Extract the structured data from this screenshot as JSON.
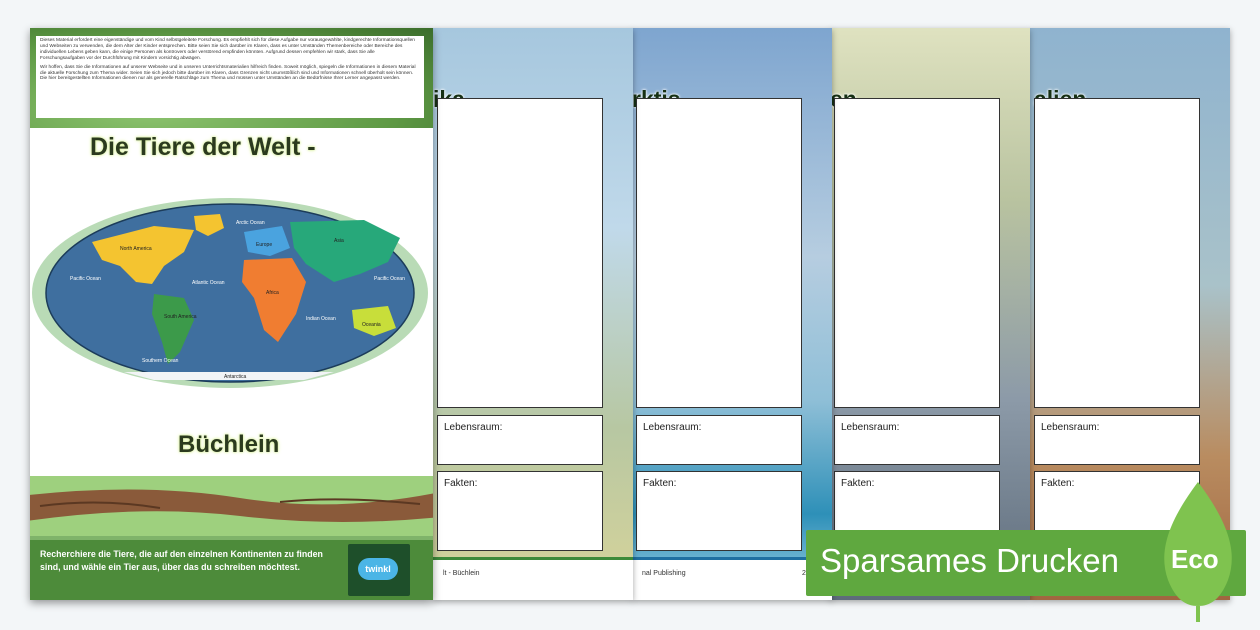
{
  "pages": [
    {
      "title": "alien",
      "habitat_label": "Lebensraum:",
      "facts_label": "Fakten:",
      "footer_left": "",
      "footer_right": ""
    },
    {
      "title": "en",
      "habitat_label": "Lebensraum:",
      "facts_label": "Fakten:",
      "footer_left": "",
      "footer_right": ""
    },
    {
      "title": "rktis",
      "habitat_label": "Lebensraum:",
      "facts_label": "Fakten:",
      "footer_left": "nal Publishing",
      "footer_right": "2"
    },
    {
      "title": "ika",
      "habitat_label": "Lebensraum:",
      "facts_label": "Fakten:",
      "footer_left": "lt - Büchlein",
      "footer_right": ""
    }
  ],
  "cover": {
    "intro_p1": "Dieses Material erfordert eine eigenständige und vom Kind selbstgeleitete Forschung. Es empfiehlt sich für diese Aufgabe nur vorausgewählte, kindgerechte Informationsquellen und Webseiten zu verwenden, die dem Alter der Kinder entsprechen. Bitte seien Sie sich darüber im Klaren, dass es unter Umständen Themenbereiche oder Bereiche des individuellen Lebens geben kann, die einige Personen als kontrovers oder verstörend empfinden könnten. Aufgrund dessen empfehlen wir stark, dass Sie alle Forschungsaufgaben vor der Durchführung mit Kindern vorsichtig abwägen.",
    "intro_p2": "Wir hoffen, dass Sie die Informationen auf unserer Webseite und in unseren Unterrichtsmaterialien hilfreich finden. Soweit möglich, spiegeln die Informationen in diesem Material die aktuelle Forschung zum Thema wider. Seien Sie sich jedoch bitte darüber im Klaren, dass Grenzen nicht unumstößlich sind und Informationen schnell überholt sein können. Die hier bereitgestellten Informationen dienen nur als generelle Ratschläge zum Thema und müssen unter Umständen an die Bedürfnisse Ihrer Lerner angepasst werden.",
    "title": "Die Tiere der Welt -",
    "subtitle": "Büchlein",
    "bottom_text": "Recherchiere die Tiere, die auf den einzelnen Kontinenten zu finden sind, und wähle ein Tier aus, über das du schreiben möchtest.",
    "logo": "twinkl",
    "map_labels": {
      "arctic": "Arctic Ocean",
      "north_america": "North America",
      "europe": "Europe",
      "asia": "Asia",
      "pacific_w": "Pacific Ocean",
      "atlantic": "Atlantic Ocean",
      "africa": "Africa",
      "pacific_e": "Pacific Ocean",
      "south_america": "South America",
      "indian": "Indian Ocean",
      "oceania": "Oceania",
      "southern": "Southern Ocean",
      "antarctica": "Antarctica"
    }
  },
  "banner": {
    "label": "Sparsames Drucken",
    "eco": "Eco"
  },
  "colors": {
    "cover_green": "#4d8b3a",
    "banner_green": "#5fa83f",
    "ocean": "#3f6f9f",
    "north_america": "#f4c430",
    "africa": "#f07d31",
    "asia": "#27a87a",
    "south_america": "#3c9a4a",
    "europe": "#4aa3df",
    "oceania": "#c8de3a"
  }
}
